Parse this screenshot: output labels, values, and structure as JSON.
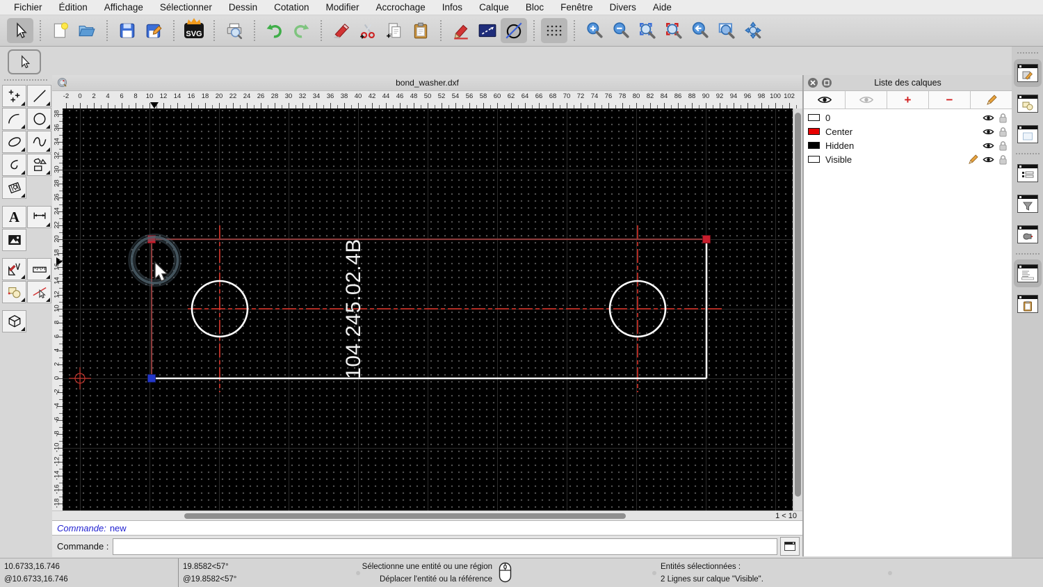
{
  "menubar": {
    "items": [
      "Fichier",
      "Édition",
      "Affichage",
      "Sélectionner",
      "Dessin",
      "Cotation",
      "Modifier",
      "Accrochage",
      "Infos",
      "Calque",
      "Bloc",
      "Fenêtre",
      "Divers",
      "Aide"
    ]
  },
  "toolbar": {
    "svg_badge_label": "SVG",
    "buttons": [
      "select",
      "new-file",
      "open-file",
      "save",
      "save-as",
      "export-svg",
      "print-preview",
      "undo",
      "redo",
      "delete",
      "cut",
      "copy",
      "paste",
      "draw-pen",
      "line-rectangle",
      "circle-line",
      "snap-grid",
      "zoom-in",
      "zoom-out",
      "zoom-auto",
      "zoom-selected",
      "zoom-previous",
      "zoom-window",
      "pan"
    ]
  },
  "left_palette": {
    "text_tool_label": "A",
    "tools": [
      "select",
      "points",
      "line",
      "arc",
      "circle",
      "ellipse",
      "spline",
      "polyline",
      "shapes",
      "hatch",
      "text",
      "dimension",
      "image",
      "modify",
      "measure",
      "blocks",
      "select-entity",
      "solid-3d"
    ]
  },
  "document_window": {
    "title": "bond_washer.dxf",
    "zoom_indicator": "1 < 10"
  },
  "rulers": {
    "top": {
      "from": -2,
      "to": 102,
      "step": 2
    },
    "left": {
      "from": -18,
      "to": 38,
      "step": 2
    }
  },
  "canvas": {
    "part_label": "104.245.02.4B",
    "selected_line_color": "#8b3a3a",
    "entity_color": "#f5f5f5",
    "centerline_color": "#e8352a",
    "handle_endpoint_color": "#c81e2d",
    "handle_start_color": "#2336c8"
  },
  "layers_panel": {
    "title": "Liste des calques",
    "add_symbol": "+",
    "remove_symbol": "−",
    "layers": [
      {
        "name": "0",
        "color": "#ffffff",
        "current": false
      },
      {
        "name": "Center",
        "color": "#e80000",
        "current": false
      },
      {
        "name": "Hidden",
        "color": "#000000",
        "current": false
      },
      {
        "name": "Visible",
        "color": "#ffffff",
        "current": true
      }
    ]
  },
  "command_widget": {
    "history_label": "Commande:",
    "history_value": "new",
    "prompt_label": "Commande :",
    "input_value": ""
  },
  "statusbar": {
    "abs_coord": "10.6733,16.746",
    "rel_coord": "@10.6733,16.746",
    "abs_polar": "19.8582<57°",
    "rel_polar": "@19.8582<57°",
    "hint_primary": "Sélectionne une entité ou une région",
    "hint_secondary": "Déplacer l'entité ou la référence",
    "selection_title": "Entités sélectionnées :",
    "selection_detail": "2 Lignes sur calque \"Visible\"."
  }
}
